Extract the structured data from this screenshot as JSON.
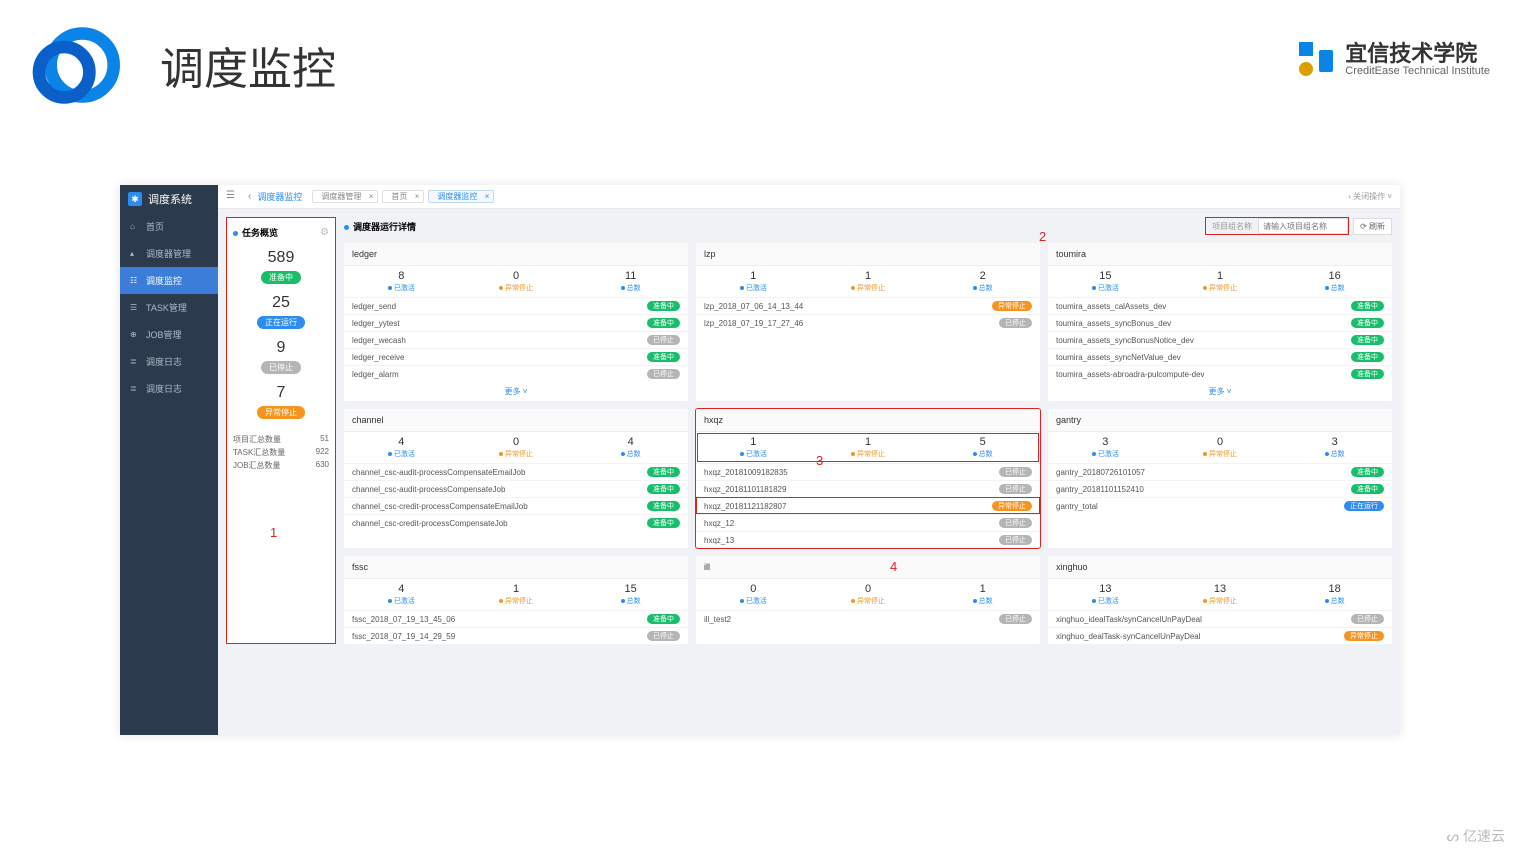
{
  "slide": {
    "title": "调度监控",
    "corp_name": "宜信技术学院",
    "corp_sub": "CreditEase Technical Institute"
  },
  "sidebar": {
    "title": "调度系统",
    "items": [
      {
        "icon": "⌂",
        "label": "首页"
      },
      {
        "icon": "▴",
        "label": "调度器管理"
      },
      {
        "icon": "☷",
        "label": "调度监控"
      },
      {
        "icon": "☰",
        "label": "TASK管理"
      },
      {
        "icon": "⊕",
        "label": "JOB管理"
      },
      {
        "icon": "≣",
        "label": "调度日志"
      },
      {
        "icon": "≣",
        "label": "调度日志"
      }
    ]
  },
  "topbar": {
    "breadcrumb": "调度器监控",
    "tabs": [
      {
        "label": "调度器管理",
        "active": false
      },
      {
        "label": "首页",
        "active": false
      },
      {
        "label": "调度器监控",
        "active": true
      }
    ],
    "right_label": "关闭操作"
  },
  "overview": {
    "title": "任务概览",
    "items": [
      {
        "num": "589",
        "pill": "准备中",
        "style": "teal"
      },
      {
        "num": "25",
        "pill": "正在运行",
        "style": "blue"
      },
      {
        "num": "9",
        "pill": "已停止",
        "style": "gray"
      },
      {
        "num": "7",
        "pill": "异常停止",
        "style": "orange"
      }
    ],
    "stats": [
      {
        "label": "项目汇总数量",
        "value": "51"
      },
      {
        "label": "TASK汇总数量",
        "value": "922"
      },
      {
        "label": "JOB汇总数量",
        "value": "630"
      }
    ]
  },
  "detail": {
    "title": "调度器运行详情",
    "search_label": "项目组名称",
    "search_placeholder": "请输入项目组名称",
    "refresh": "刷新",
    "stat_labels": {
      "active": "已激活",
      "error": "异常停止",
      "total": "总数"
    },
    "more": "更多",
    "row3_inner_hl": true
  },
  "cards": [
    [
      {
        "name": "ledger",
        "stats": [
          "8",
          "0",
          "11"
        ],
        "jobs": [
          {
            "n": "ledger_send",
            "t": "准备中",
            "s": "teal"
          },
          {
            "n": "ledger_yytest",
            "t": "准备中",
            "s": "teal"
          },
          {
            "n": "ledger_wecash",
            "t": "已停止",
            "s": "gray"
          },
          {
            "n": "ledger_receive",
            "t": "准备中",
            "s": "teal"
          },
          {
            "n": "ledger_alarm",
            "t": "已停止",
            "s": "gray"
          }
        ],
        "more": true
      },
      {
        "name": "lzp",
        "stats": [
          "1",
          "1",
          "2"
        ],
        "jobs": [
          {
            "n": "lzp_2018_07_06_14_13_44",
            "t": "异常停止",
            "s": "orange"
          },
          {
            "n": "lzp_2018_07_19_17_27_46",
            "t": "已停止",
            "s": "gray"
          }
        ]
      },
      {
        "name": "toumira",
        "stats": [
          "15",
          "1",
          "16"
        ],
        "jobs": [
          {
            "n": "toumira_assets_calAssets_dev",
            "t": "准备中",
            "s": "teal"
          },
          {
            "n": "toumira_assets_syncBonus_dev",
            "t": "准备中",
            "s": "teal"
          },
          {
            "n": "toumira_assets_syncBonusNotice_dev",
            "t": "准备中",
            "s": "teal"
          },
          {
            "n": "toumira_assets_syncNetValue_dev",
            "t": "准备中",
            "s": "teal"
          },
          {
            "n": "toumira_assets-abroadra-pulcompute-dev",
            "t": "准备中",
            "s": "teal"
          }
        ],
        "more": true
      }
    ],
    [
      {
        "name": "channel",
        "stats": [
          "4",
          "0",
          "4"
        ],
        "jobs": [
          {
            "n": "channel_csc-audit-processCompensateEmailJob",
            "t": "准备中",
            "s": "teal"
          },
          {
            "n": "channel_csc-audit-processCompensateJob",
            "t": "准备中",
            "s": "teal"
          },
          {
            "n": "channel_csc-credit-processCompensateEmailJob",
            "t": "准备中",
            "s": "teal"
          },
          {
            "n": "channel_csc-credit-processCompensateJob",
            "t": "准备中",
            "s": "teal"
          }
        ]
      },
      {
        "name": "hxqz",
        "stats": [
          "1",
          "1",
          "5"
        ],
        "hl": true,
        "jobs": [
          {
            "n": "hxqz_20181009182835",
            "t": "已停止",
            "s": "gray"
          },
          {
            "n": "hxqz_20181101181829",
            "t": "已停止",
            "s": "gray"
          },
          {
            "n": "hxqz_20181121182807",
            "t": "异常停止",
            "s": "orange",
            "hl": true
          },
          {
            "n": "hxqz_12",
            "t": "已停止",
            "s": "gray"
          },
          {
            "n": "hxqz_13",
            "t": "已停止",
            "s": "gray"
          }
        ]
      },
      {
        "name": "gantry",
        "stats": [
          "3",
          "0",
          "3"
        ],
        "jobs": [
          {
            "n": "gantry_20180726101057",
            "t": "准备中",
            "s": "teal"
          },
          {
            "n": "gantry_20181101152410",
            "t": "准备中",
            "s": "teal"
          },
          {
            "n": "gantry_total",
            "t": "正在运行",
            "s": "blue"
          }
        ]
      }
    ],
    [
      {
        "name": "fssc",
        "stats": [
          "4",
          "1",
          "15"
        ],
        "jobs": [
          {
            "n": "fssc_2018_07_19_13_45_06",
            "t": "准备中",
            "s": "teal"
          },
          {
            "n": "fssc_2018_07_19_14_29_59",
            "t": "已停止",
            "s": "gray"
          }
        ]
      },
      {
        "name": "ill",
        "stats": [
          "0",
          "0",
          "1"
        ],
        "jobs": [
          {
            "n": "ill_test2",
            "t": "已停止",
            "s": "gray"
          }
        ]
      },
      {
        "name": "xinghuo",
        "stats": [
          "13",
          "13",
          "18"
        ],
        "jobs": [
          {
            "n": "xinghuo_idealTask/synCancelUnPayDeal",
            "t": "已停止",
            "s": "gray"
          },
          {
            "n": "xinghuo_dealTask-synCancelUnPayDeal",
            "t": "异常停止",
            "s": "orange"
          }
        ]
      }
    ]
  ],
  "annotations": {
    "a1": "1",
    "a2": "2",
    "a3": "3",
    "a4": "4"
  },
  "watermark": "亿速云"
}
